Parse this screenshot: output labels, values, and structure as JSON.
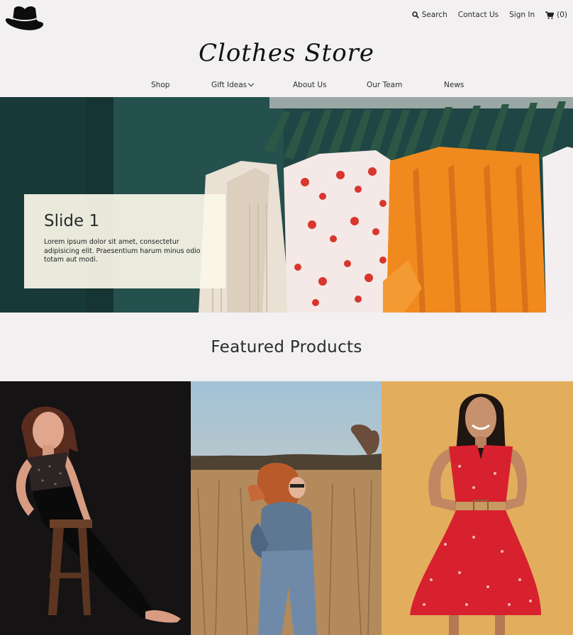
{
  "header": {
    "logo_icon": "cowboy-hat-icon",
    "search_label": "Search",
    "contact_label": "Contact Us",
    "signin_label": "Sign In",
    "cart_label": "(0)",
    "brand_title": "Clothes Store"
  },
  "nav": {
    "items": [
      {
        "label": "Shop"
      },
      {
        "label": "Gift Ideas",
        "dropdown": true
      },
      {
        "label": "About Us"
      },
      {
        "label": "Our Team"
      },
      {
        "label": "News"
      }
    ]
  },
  "hero": {
    "title": "Slide 1",
    "text": "Lorem ipsum dolor sit amet, consectetur adipisicing elit. Praesentium harum minus odio totam aut modi."
  },
  "featured": {
    "title": "Featured Products",
    "products": [
      {
        "image": "woman in black outfit on wooden stool"
      },
      {
        "image": "woman in denim jacket in field"
      },
      {
        "image": "woman in red floral dress"
      }
    ]
  },
  "colors": {
    "page_bg": "#f2f0f1",
    "hero_wall": "#1f4544",
    "orange": "#f08a1e",
    "product2_sky": "#8fb4cc",
    "product3_bg": "#e2ae5e",
    "dress_red": "#d8212e"
  }
}
